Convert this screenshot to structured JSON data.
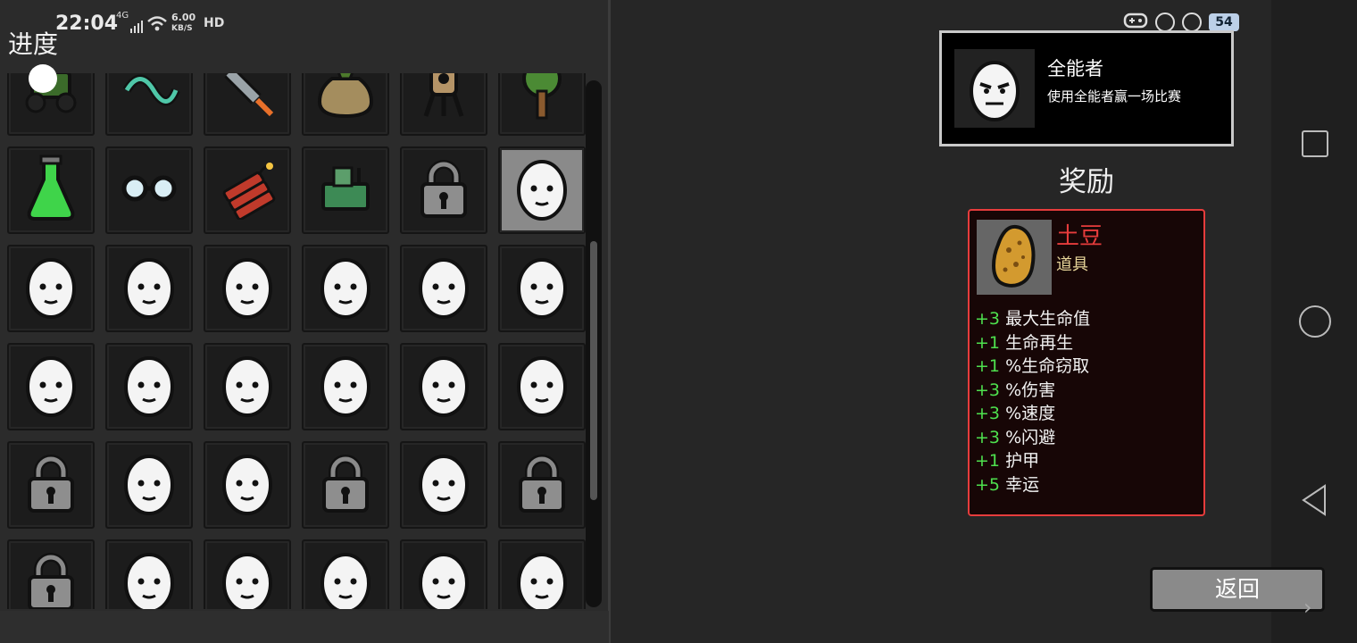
{
  "status_bar": {
    "time": "22:04",
    "network": "4G",
    "speed_value": "6.00",
    "speed_unit": "KB/S",
    "hd": "HD",
    "battery": "54"
  },
  "page_title": "进度",
  "grid": {
    "cells": [
      "lawnmower-icon",
      "tentacle-icon",
      "rocket-icon",
      "money-bag-icon",
      "turret-icon",
      "tree-icon",
      "potion-flask-icon",
      "glasses-icon",
      "dynamite-icon",
      "machine-icon",
      "padlock-icon",
      "egg-character-icon",
      "egg-character-icon",
      "egg-character-icon",
      "egg-character-icon",
      "egg-character-icon",
      "egg-character-icon",
      "egg-character-icon",
      "egg-character-icon",
      "egg-character-icon",
      "egg-character-icon",
      "egg-character-icon",
      "egg-character-icon",
      "egg-character-icon",
      "padlock-icon",
      "egg-character-icon",
      "egg-character-icon",
      "padlock-icon",
      "egg-character-icon",
      "padlock-icon",
      "padlock-icon",
      "egg-character-icon",
      "egg-character-icon",
      "egg-character-icon",
      "egg-character-icon",
      "egg-character-icon"
    ],
    "selected_index": 11
  },
  "achievement": {
    "name": "全能者",
    "description": "使用全能者赢一场比赛"
  },
  "reward": {
    "title": "奖励",
    "item_name": "土豆",
    "item_type": "道具",
    "stats": [
      {
        "value": "+3",
        "label": "最大生命值"
      },
      {
        "value": "+1",
        "label": "生命再生"
      },
      {
        "value": "+1",
        "label": "%生命窃取"
      },
      {
        "value": "+3",
        "label": "%伤害"
      },
      {
        "value": "+3",
        "label": "%速度"
      },
      {
        "value": "+3",
        "label": "%闪避"
      },
      {
        "value": "+1",
        "label": "护甲"
      },
      {
        "value": "+5",
        "label": "幸运"
      }
    ]
  },
  "back_button": "返回",
  "colors": {
    "stat_value": "#4ee04e",
    "item_name": "#e63c3c",
    "reward_border": "#e63c3c",
    "item_type": "#e8d69a"
  }
}
